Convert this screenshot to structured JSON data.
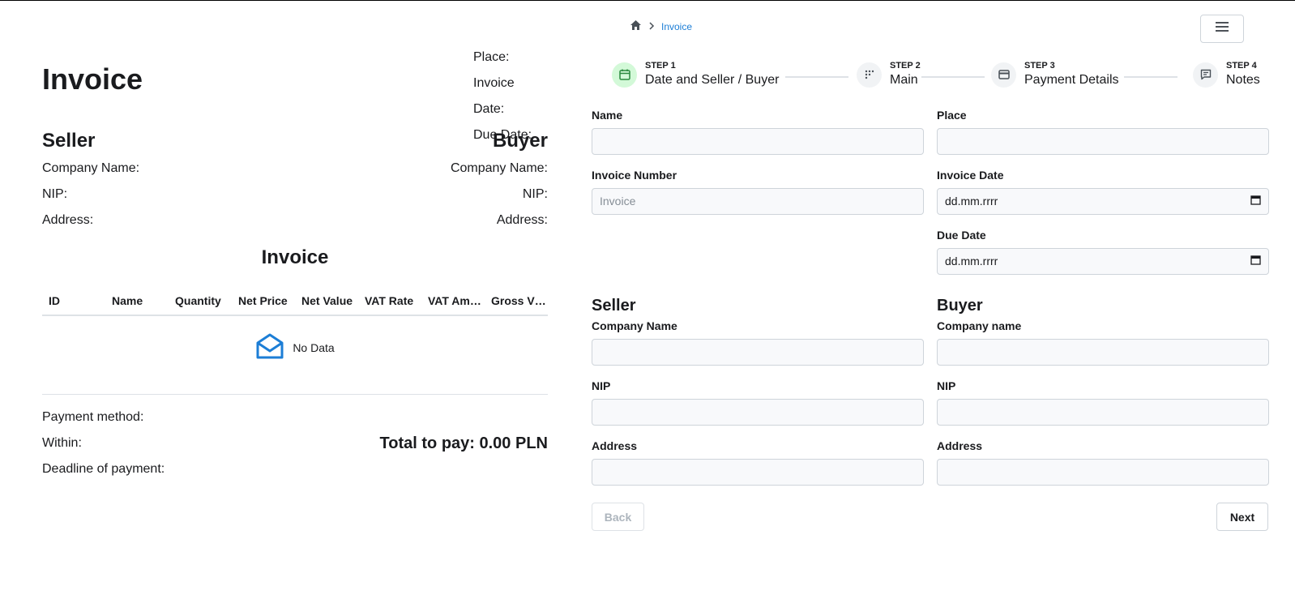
{
  "preview": {
    "title": "Invoice",
    "meta": {
      "place": "Place:",
      "invoice_date": "Invoice Date:",
      "due_date": "Due Date:"
    },
    "seller": {
      "heading": "Seller",
      "company": "Company Name:",
      "nip": "NIP:",
      "address": "Address:"
    },
    "buyer": {
      "heading": "Buyer",
      "company": "Company Name:",
      "nip": "NIP:",
      "address": "Address:"
    },
    "table_title": "Invoice",
    "columns": [
      "ID",
      "Name",
      "Quantity",
      "Net Price",
      "Net Value",
      "VAT Rate",
      "VAT Am…",
      "Gross V…"
    ],
    "no_data": "No Data",
    "payment_method": "Payment method:",
    "within": "Within:",
    "deadline": "Deadline of payment:",
    "total": "Total to pay: 0.00 PLN"
  },
  "breadcrumb": {
    "current": "Invoice"
  },
  "steps": [
    {
      "no": "STEP 1",
      "label": "Date and Seller / Buyer"
    },
    {
      "no": "STEP 2",
      "label": "Main"
    },
    {
      "no": "STEP 3",
      "label": "Payment Details"
    },
    {
      "no": "STEP 4",
      "label": "Notes"
    }
  ],
  "form": {
    "name_label": "Name",
    "place_label": "Place",
    "invoice_number_label": "Invoice Number",
    "invoice_number_placeholder": "Invoice",
    "invoice_date_label": "Invoice Date",
    "invoice_date_value": "dd.mm.rrrr",
    "due_date_label": "Due Date",
    "due_date_value": "dd.mm.rrrr",
    "seller_heading": "Seller",
    "buyer_heading": "Buyer",
    "seller_company_label": "Company Name",
    "buyer_company_label": "Company name",
    "seller_nip_label": "NIP",
    "buyer_nip_label": "NIP",
    "seller_address_label": "Address",
    "buyer_address_label": "Address",
    "back": "Back",
    "next": "Next"
  }
}
